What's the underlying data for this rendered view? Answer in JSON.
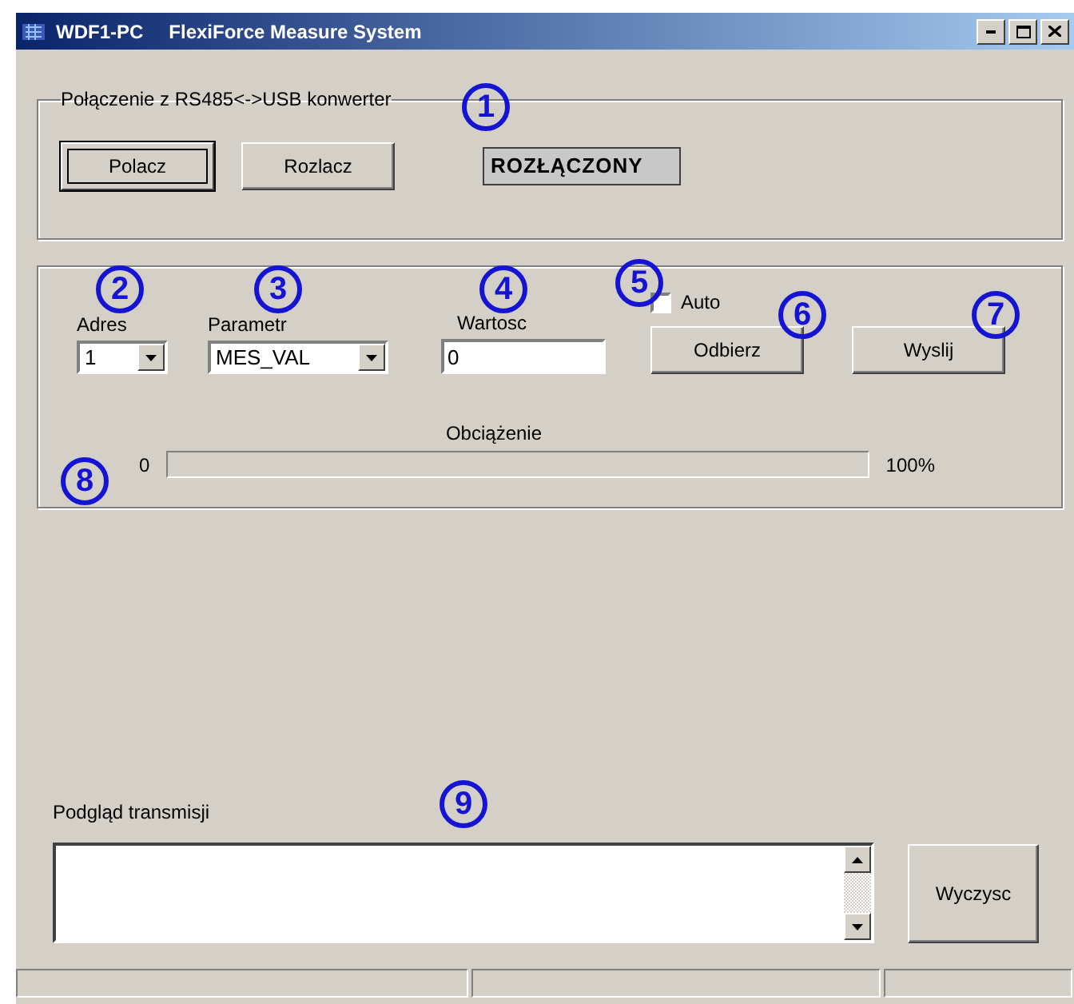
{
  "window": {
    "title": "WDF1-PC",
    "subtitle": "FlexiForce Measure System"
  },
  "connection": {
    "legend": "Połączenie z RS485<->USB konwerter",
    "buttons": [
      {
        "label": "Polacz",
        "focused": true
      },
      {
        "label": "Rozlacz",
        "focused": false
      }
    ],
    "status": "ROZŁĄCZONY"
  },
  "parameters": {
    "address": {
      "label": "Adres",
      "value": "1"
    },
    "parameter": {
      "label": "Parametr",
      "value": "MES_VAL"
    },
    "value": {
      "label": "Wartosc",
      "value": "0"
    },
    "auto": {
      "label": "Auto",
      "checked": false
    },
    "buttons": [
      "Odbierz",
      "Wyslij"
    ],
    "load": {
      "label": "Obciążenie",
      "min": "0",
      "max": "100%",
      "level": 0
    }
  },
  "transmission": {
    "label": "Podgląd transmisji",
    "button": "Wyczysc"
  },
  "markers": [
    "1",
    "2",
    "3",
    "4",
    "5",
    "6",
    "7",
    "8",
    "9"
  ]
}
